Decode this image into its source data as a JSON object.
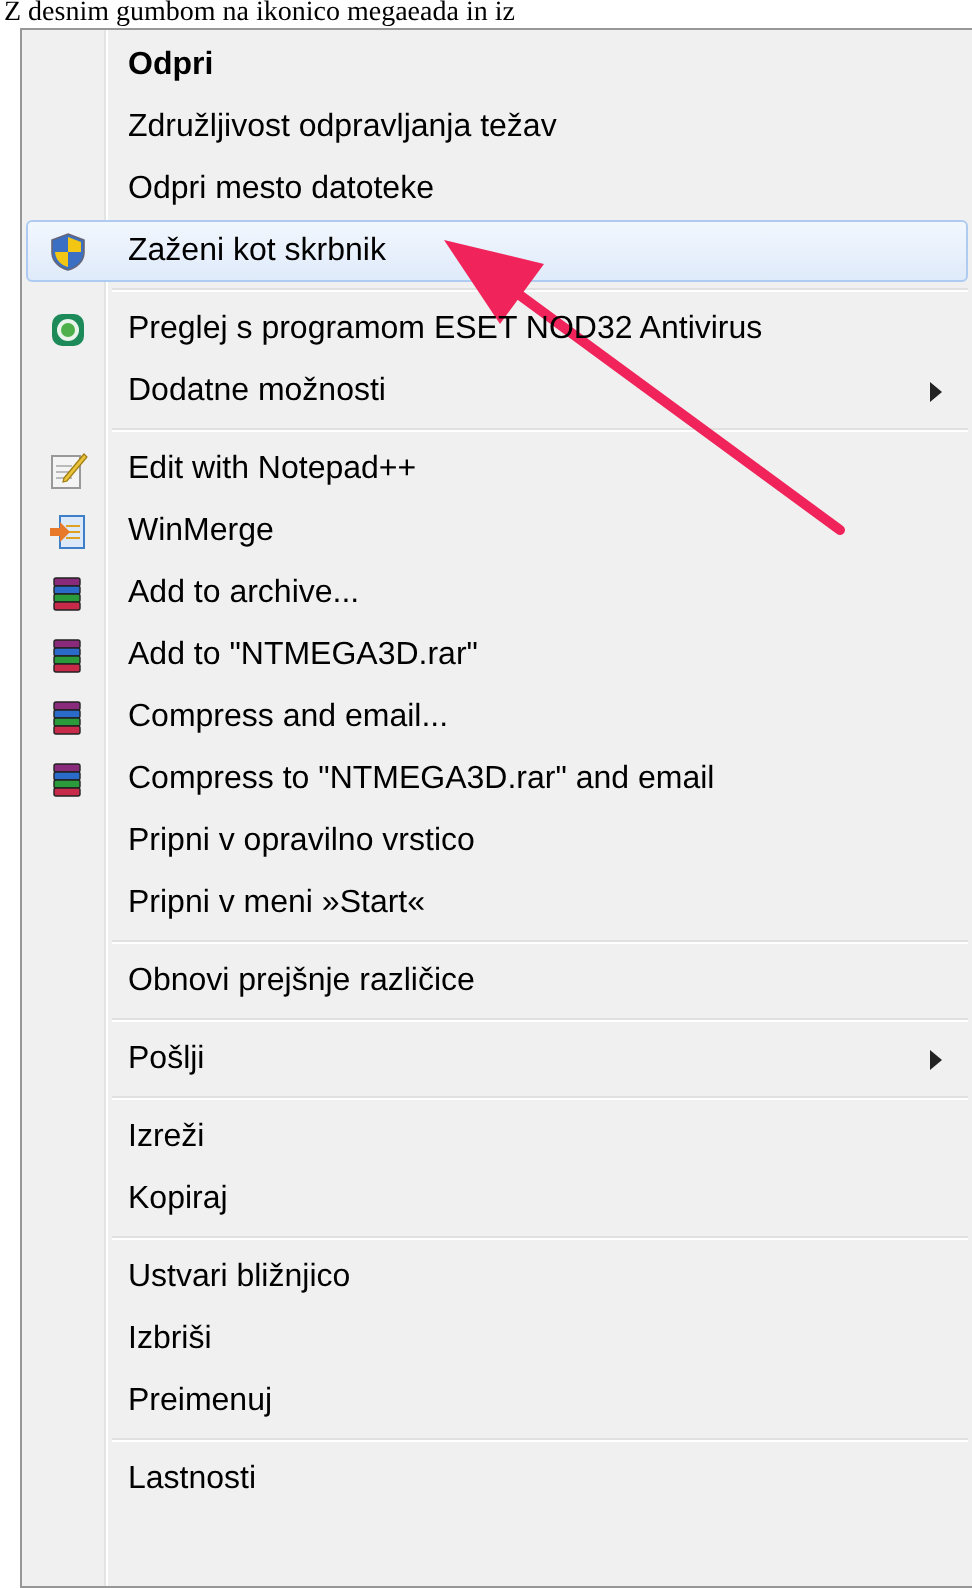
{
  "caption": "Z desnim gumbom na ikonico megaeada in iz",
  "menu": {
    "items": [
      {
        "kind": "plain",
        "label": "Odpri",
        "default": true,
        "selected": false,
        "submenu": false
      },
      {
        "kind": "plain",
        "label": "Združljivost odpravljanja težav",
        "default": false,
        "selected": false,
        "submenu": false
      },
      {
        "kind": "plain",
        "label": "Odpri mesto datoteke",
        "default": false,
        "selected": false,
        "submenu": false
      },
      {
        "kind": "shield",
        "label": "Zaženi kot skrbnik",
        "default": false,
        "selected": true,
        "submenu": false
      },
      {
        "kind": "separator"
      },
      {
        "kind": "eset",
        "label": "Preglej s programom ESET NOD32 Antivirus",
        "default": false,
        "selected": false,
        "submenu": false
      },
      {
        "kind": "plain",
        "label": "Dodatne možnosti",
        "default": false,
        "selected": false,
        "submenu": true
      },
      {
        "kind": "separator"
      },
      {
        "kind": "notepad",
        "label": "Edit with Notepad++",
        "default": false,
        "selected": false,
        "submenu": false
      },
      {
        "kind": "winmerge",
        "label": "WinMerge",
        "default": false,
        "selected": false,
        "submenu": false
      },
      {
        "kind": "archive",
        "label": "Add to archive...",
        "default": false,
        "selected": false,
        "submenu": false
      },
      {
        "kind": "archive",
        "label": "Add to \"NTMEGA3D.rar\"",
        "default": false,
        "selected": false,
        "submenu": false
      },
      {
        "kind": "archive",
        "label": "Compress and email...",
        "default": false,
        "selected": false,
        "submenu": false
      },
      {
        "kind": "archive",
        "label": "Compress to \"NTMEGA3D.rar\" and email",
        "default": false,
        "selected": false,
        "submenu": false
      },
      {
        "kind": "plain",
        "label": "Pripni v opravilno vrstico",
        "default": false,
        "selected": false,
        "submenu": false
      },
      {
        "kind": "plain",
        "label": "Pripni v meni »Start«",
        "default": false,
        "selected": false,
        "submenu": false
      },
      {
        "kind": "separator"
      },
      {
        "kind": "plain",
        "label": "Obnovi prejšnje različice",
        "default": false,
        "selected": false,
        "submenu": false
      },
      {
        "kind": "separator"
      },
      {
        "kind": "plain",
        "label": "Pošlji",
        "default": false,
        "selected": false,
        "submenu": true
      },
      {
        "kind": "separator"
      },
      {
        "kind": "plain",
        "label": "Izreži",
        "default": false,
        "selected": false,
        "submenu": false
      },
      {
        "kind": "plain",
        "label": "Kopiraj",
        "default": false,
        "selected": false,
        "submenu": false
      },
      {
        "kind": "separator"
      },
      {
        "kind": "plain",
        "label": "Ustvari bližnjico",
        "default": false,
        "selected": false,
        "submenu": false
      },
      {
        "kind": "plain",
        "label": "Izbriši",
        "default": false,
        "selected": false,
        "submenu": false
      },
      {
        "kind": "plain",
        "label": "Preimenuj",
        "default": false,
        "selected": false,
        "submenu": false
      },
      {
        "kind": "separator"
      },
      {
        "kind": "plain",
        "label": "Lastnosti",
        "default": false,
        "selected": false,
        "submenu": false
      }
    ]
  }
}
